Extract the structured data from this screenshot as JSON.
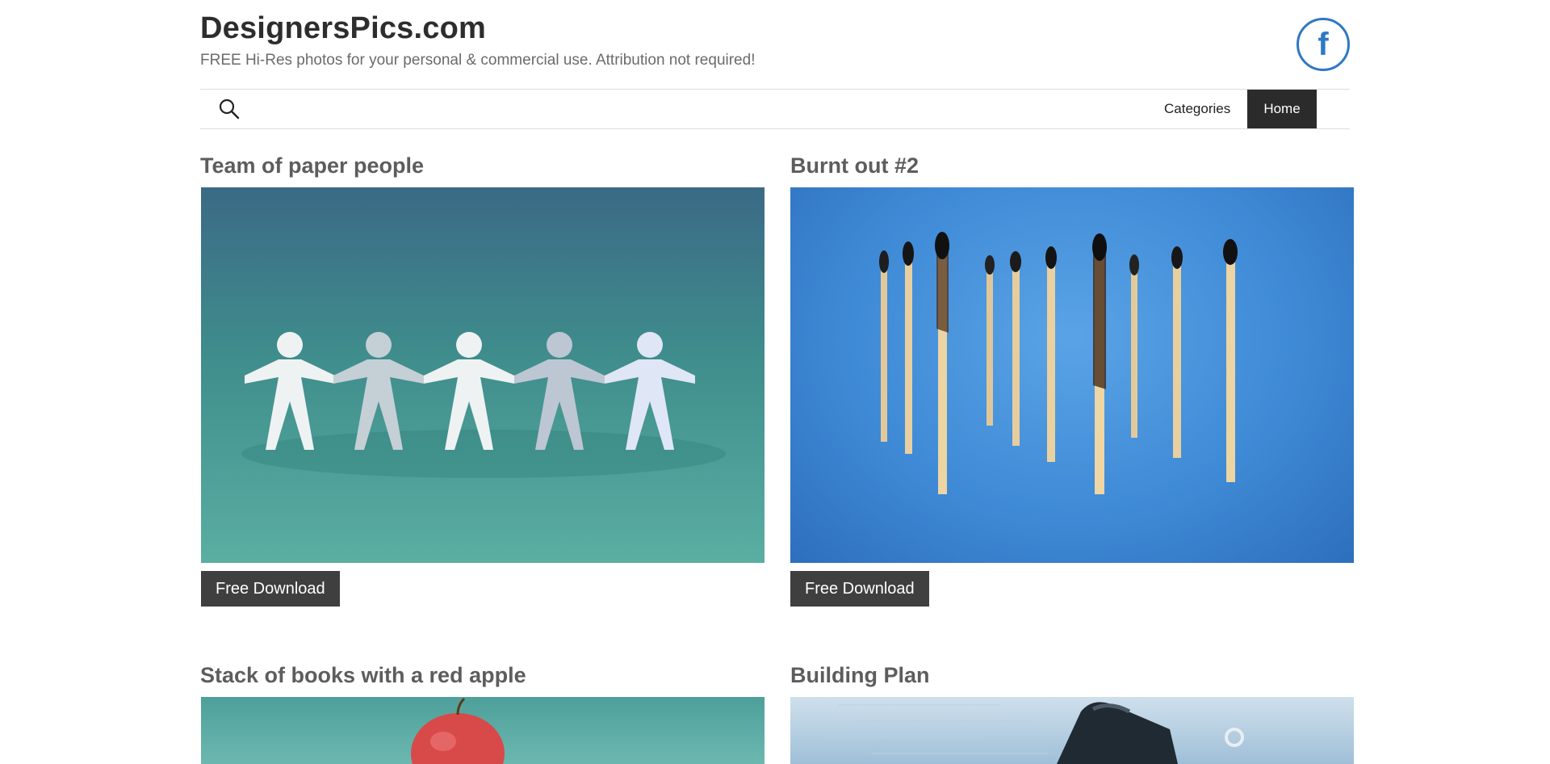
{
  "header": {
    "site_title": "DesignersPics.com",
    "tagline": "FREE Hi-Res photos for your personal & commercial use. Attribution not required!",
    "social_icon": "facebook-icon",
    "social_glyph": "f"
  },
  "nav": {
    "search_icon": "search-icon",
    "items": [
      {
        "label": "Categories"
      },
      {
        "label": "Home",
        "active": true
      }
    ]
  },
  "posts": [
    {
      "title": "Team of paper people",
      "button": "Free Download"
    },
    {
      "title": "Burnt out #2",
      "button": "Free Download"
    },
    {
      "title": "Stack of books with a red apple"
    },
    {
      "title": "Building Plan"
    }
  ],
  "colors": {
    "brand_blue": "#2f78c4",
    "button_dark": "#3f3f3f",
    "nav_active": "#2b2b2b"
  }
}
